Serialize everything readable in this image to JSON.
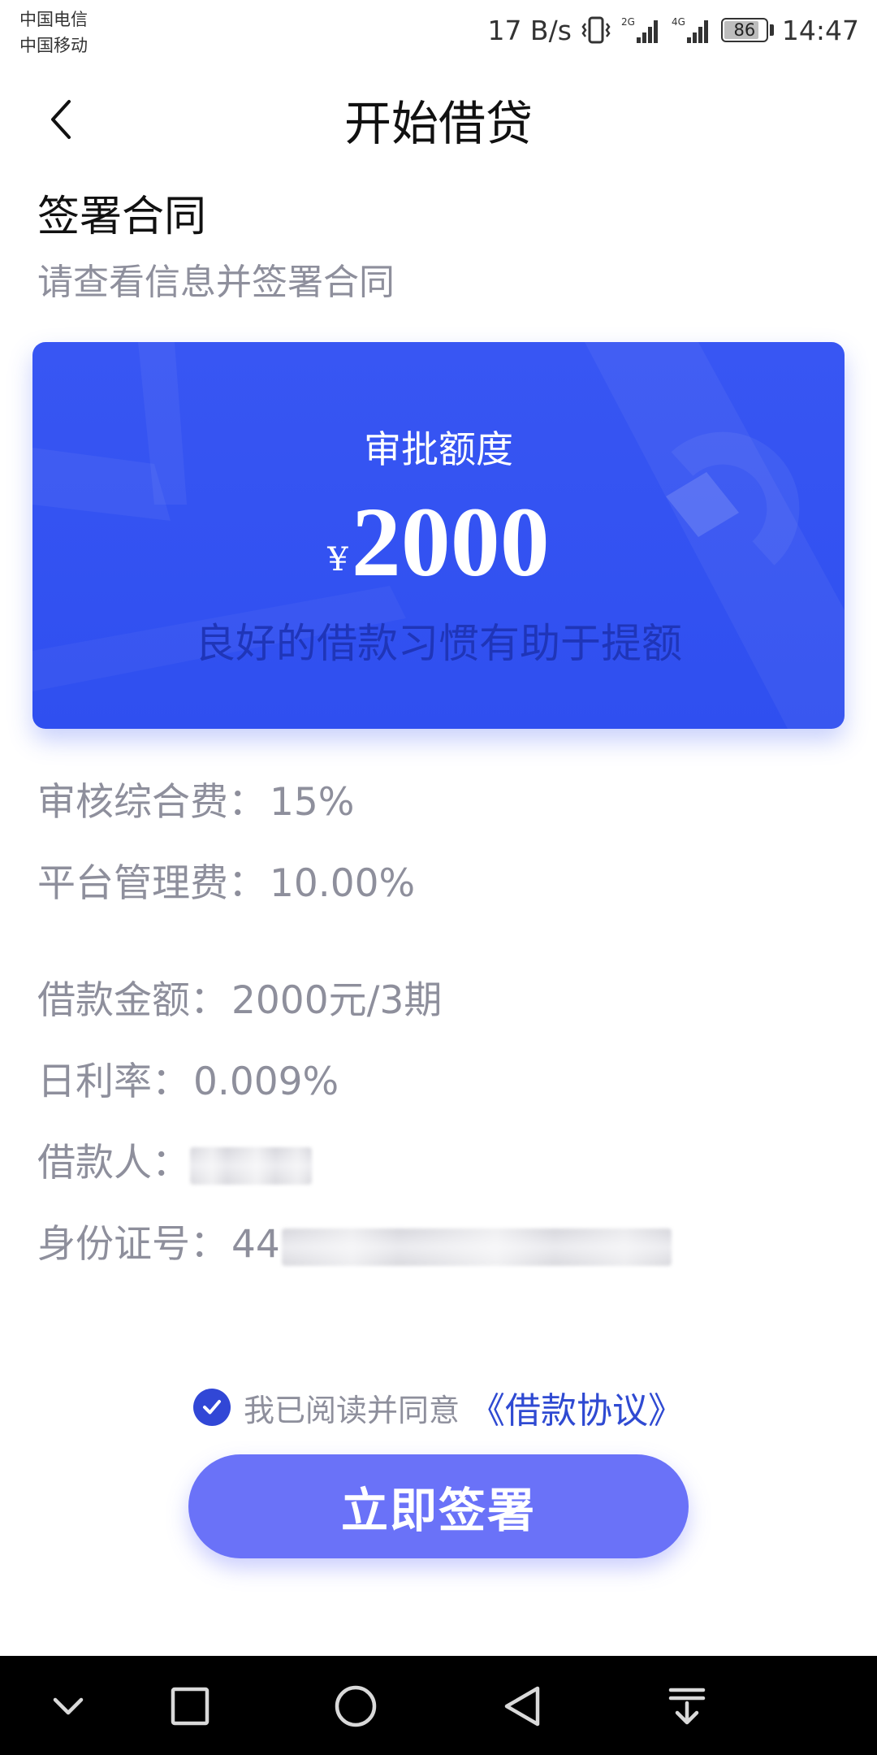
{
  "status_bar": {
    "carrier_1": "中国电信",
    "carrier_2": "中国移动",
    "network_speed": "17 B/s",
    "signal_1_type": "2G",
    "signal_2_type": "4G",
    "battery_level": "86",
    "battery_fraction": 0.86,
    "time": "14:47",
    "icons": [
      "vibrate-icon",
      "signal-2g-icon",
      "signal-4g-icon",
      "battery-icon"
    ]
  },
  "nav": {
    "back_icon": "chevron-left-icon",
    "title": "开始借贷"
  },
  "section": {
    "title": "签署合同",
    "subtitle": "请查看信息并签署合同"
  },
  "card": {
    "label": "审批额度",
    "currency": "¥",
    "amount": "2000",
    "tagline": "良好的借款习惯有助于提额",
    "color": "#3452f2"
  },
  "fees": {
    "review_fee_label": "审核综合费：",
    "review_fee_value": "15%",
    "platform_fee_label": "平台管理费：",
    "platform_fee_value": "10.00%"
  },
  "loan": {
    "amount_label": "借款金额：",
    "amount_value": "2000元/3期",
    "daily_rate_label": "日利率：",
    "daily_rate_value": "0.009%",
    "borrower_label": "借款人：",
    "id_label": "身份证号：",
    "id_prefix": "44"
  },
  "agreement": {
    "checked": true,
    "text": "我已阅读并同意",
    "link": "《借款协议》"
  },
  "action": {
    "sign_label": "立即签署",
    "color": "#6a72f8"
  },
  "system_nav": {
    "icons": [
      "collapse-icon",
      "recent-apps-icon",
      "home-icon",
      "back-icon",
      "notification-pull-icon"
    ]
  }
}
